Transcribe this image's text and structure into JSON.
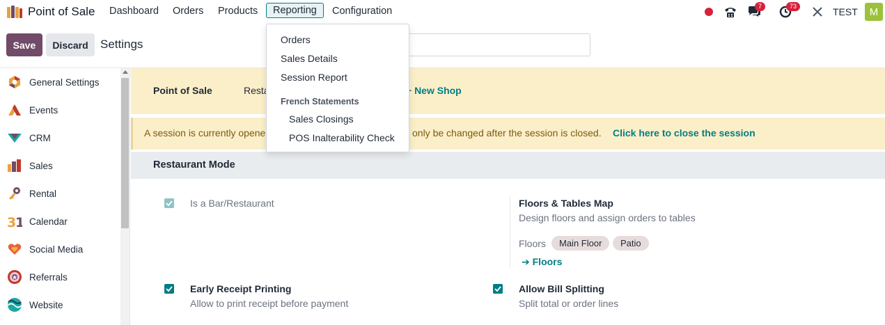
{
  "navbar": {
    "app_name": "Point of Sale",
    "menu": [
      "Dashboard",
      "Orders",
      "Products",
      "Reporting",
      "Configuration"
    ],
    "active_menu": "Reporting",
    "messages_count": "7",
    "activities_count": "73",
    "company": "TEST",
    "avatar_letter": "M"
  },
  "control_panel": {
    "save_label": "Save",
    "discard_label": "Discard",
    "title": "Settings"
  },
  "sidebar": {
    "items": [
      {
        "label": "General Settings",
        "icon": "general-settings-icon"
      },
      {
        "label": "Events",
        "icon": "events-icon"
      },
      {
        "label": "CRM",
        "icon": "crm-icon"
      },
      {
        "label": "Sales",
        "icon": "sales-icon"
      },
      {
        "label": "Rental",
        "icon": "rental-icon"
      },
      {
        "label": "Calendar",
        "icon": "calendar-icon"
      },
      {
        "label": "Social Media",
        "icon": "social-media-icon"
      },
      {
        "label": "Referrals",
        "icon": "referrals-icon"
      },
      {
        "label": "Website",
        "icon": "website-icon"
      }
    ]
  },
  "tabs": {
    "first": "Point of Sale",
    "second": "Resta",
    "new_shop": "+ New Shop"
  },
  "alert": {
    "text_left": "A session is currently opene",
    "text_right": "only be changed after the session is closed.",
    "link": "Click here to close the session"
  },
  "section": {
    "title": "Restaurant Mode"
  },
  "settings": {
    "bar_restaurant": {
      "label": "Is a Bar/Restaurant",
      "checked": true
    },
    "floors_map": {
      "label": "Floors & Tables Map",
      "desc": "Design floors and assign orders to tables"
    },
    "floors_field_label": "Floors",
    "floor_tags": [
      "Main Floor",
      "Patio"
    ],
    "floors_link": "Floors",
    "early_receipt": {
      "label": "Early Receipt Printing",
      "desc": "Allow to print receipt before payment",
      "checked": true
    },
    "bill_splitting": {
      "label": "Allow Bill Splitting",
      "desc": "Split total or order lines",
      "checked": true
    }
  },
  "dropdown": {
    "items": [
      "Orders",
      "Sales Details",
      "Session Report"
    ],
    "group_header": "French Statements",
    "group_items": [
      "Sales Closings",
      "POS Inalterability Check"
    ]
  },
  "colors": {
    "primary": "#714b67",
    "accent": "#017e84",
    "warning_bg": "#fbefc9",
    "badge": "#d9213c"
  }
}
